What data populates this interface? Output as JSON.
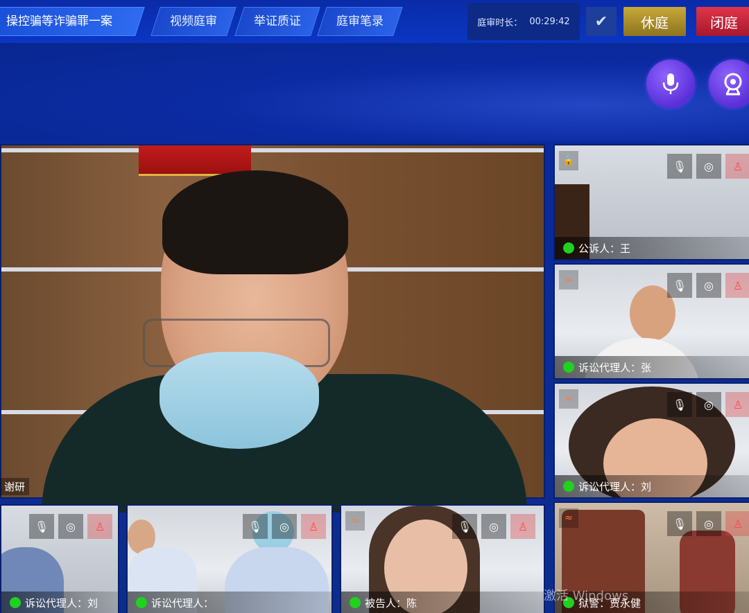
{
  "header": {
    "case_title": "操控骗等诈骗罪一案",
    "tabs": [
      {
        "label": "视频庭审"
      },
      {
        "label": "举证质证"
      },
      {
        "label": "庭审笔录"
      }
    ],
    "timer": {
      "label": "庭审时长：",
      "value": "00:29:42"
    },
    "adjourn_label": "休庭",
    "close_label": "闭庭"
  },
  "controls": {
    "mic_icon": "microphone-icon",
    "camera_icon": "camera-icon"
  },
  "main_video": {
    "name": "谢研"
  },
  "side_tiles": [
    {
      "role": "公诉人：王",
      "signal": "🔒",
      "status": "online"
    },
    {
      "role": "诉讼代理人：张",
      "signal": "≈",
      "status": "online"
    },
    {
      "role": "诉讼代理人：刘",
      "signal": "≈",
      "status": "online"
    },
    {
      "role": "狱警：贾永健",
      "signal": "≈",
      "status": "online"
    }
  ],
  "bottom_tiles": [
    {
      "role": "诉讼代理人：刘",
      "status": "online"
    },
    {
      "role": "诉讼代理人：",
      "status": "online"
    },
    {
      "role": "被告人：陈",
      "signal": "≈",
      "status": "online"
    }
  ],
  "os_watermark": "激活 Windows",
  "colors": {
    "status_online": "#1ed21e",
    "adjourn": "#c8a838",
    "close": "#e0354a",
    "control_button": "#6a3de6"
  }
}
